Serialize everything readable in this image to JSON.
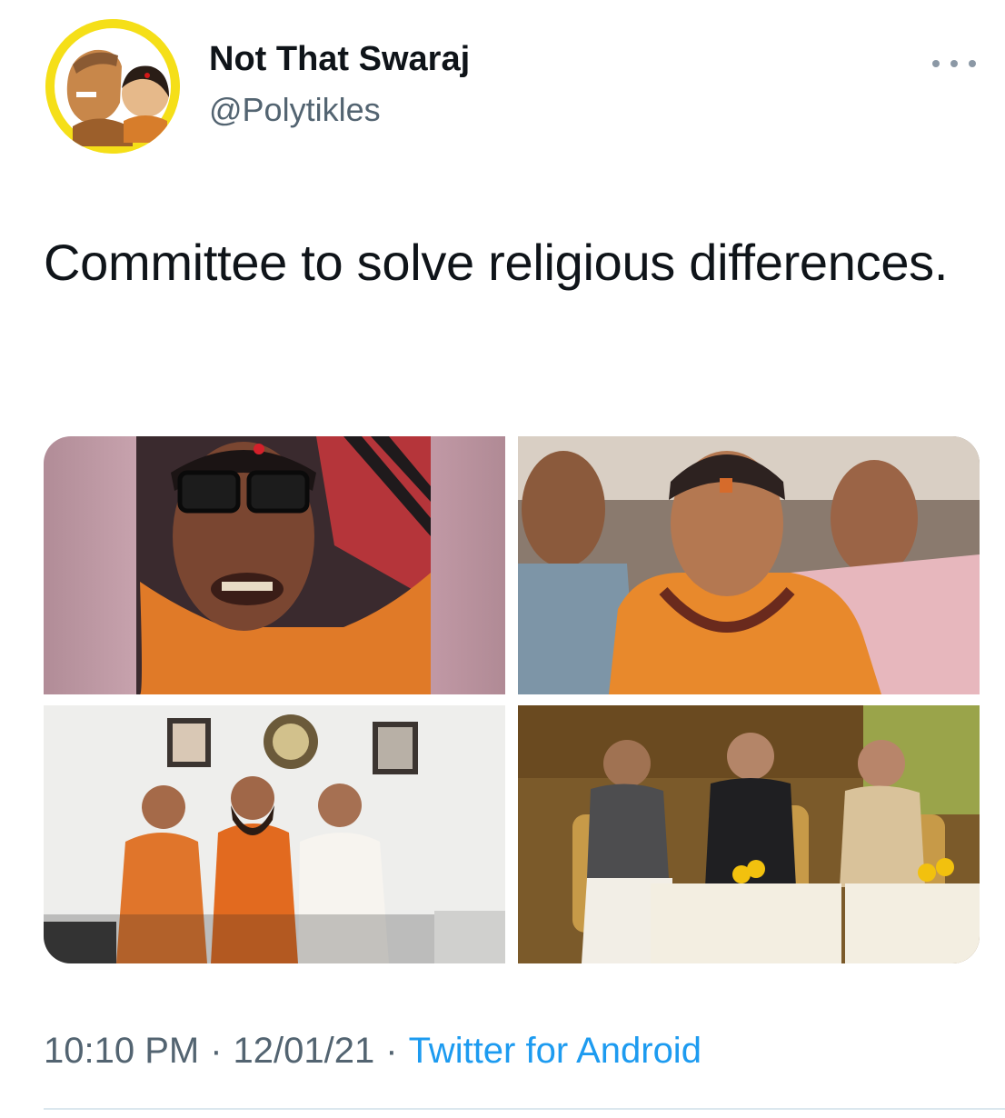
{
  "author": {
    "display_name": "Not That Swaraj",
    "handle": "@Polytikles",
    "avatar_icon": "avatar-caricature-image"
  },
  "more_icon": "more-horizontal-icon",
  "tweet": {
    "text": "Committee to solve religious differences.",
    "media": [
      {
        "icon": "photo-woman-in-saffron-with-glasses"
      },
      {
        "icon": "photo-woman-in-saffron-with-rudraksha"
      },
      {
        "icon": "photo-three-men-posing-in-office"
      },
      {
        "icon": "photo-three-men-seated-on-stage"
      }
    ]
  },
  "footer": {
    "time": "10:10 PM",
    "separator": "·",
    "date": "12/01/21",
    "source": "Twitter for Android"
  },
  "colors": {
    "text": "#0f1419",
    "secondary": "#536471",
    "link": "#1d9bf0",
    "avatar_ring": "#f7e21a"
  }
}
